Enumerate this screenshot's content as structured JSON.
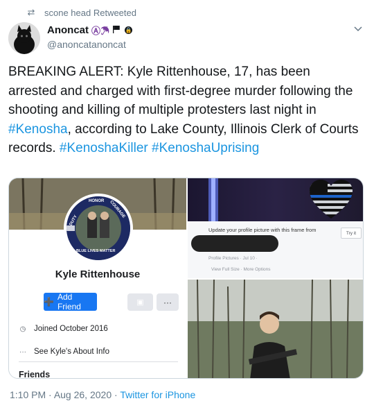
{
  "retweet": {
    "label": "scone head Retweeted",
    "icon": "retweet-icon"
  },
  "author": {
    "display_name": "Anoncat",
    "emoji_glyphs": "Ⓐ☂",
    "handle": "@anoncatanoncat"
  },
  "tweet": {
    "segments": [
      {
        "text": "BREAKING ALERT: Kyle Rittenhouse, 17, has been arrested and charged with first-degree murder following the shooting and killing of multiple protesters last night in ",
        "type": "text"
      },
      {
        "text": "#Kenosha",
        "type": "hashtag"
      },
      {
        "text": ", according to Lake County, Illinois Clerk of Courts records. ",
        "type": "text"
      },
      {
        "text": "#KenoshaKiller",
        "type": "hashtag"
      },
      {
        "text": " ",
        "type": "text"
      },
      {
        "text": "#KenoshaUprising",
        "type": "hashtag"
      }
    ]
  },
  "media": {
    "left_image": {
      "profile_name": "Kyle Rittenhouse",
      "add_friend_label": "Add Friend",
      "more_label": "···",
      "joined": "Joined October 2016",
      "about": "See Kyle's About Info",
      "friends_heading": "Friends",
      "badge_top": "HONOR",
      "badge_left": "DUTY",
      "badge_right": "COURAGE",
      "badge_bottom": "BLUE LIVES MATTER"
    },
    "right_top_image": {
      "update_text": "Update your profile picture with this frame from",
      "try_it": "Try it",
      "profile_pictures": "Profile Pictures · Jul 10 ·",
      "view_full": "View Full Size · More Options"
    }
  },
  "footer": {
    "time": "1:10 PM",
    "date": "Aug 26, 2020",
    "via": "Twitter for iPhone"
  },
  "colors": {
    "link": "#1b95e0",
    "secondary": "#657786",
    "fb_blue": "#1877f2"
  }
}
